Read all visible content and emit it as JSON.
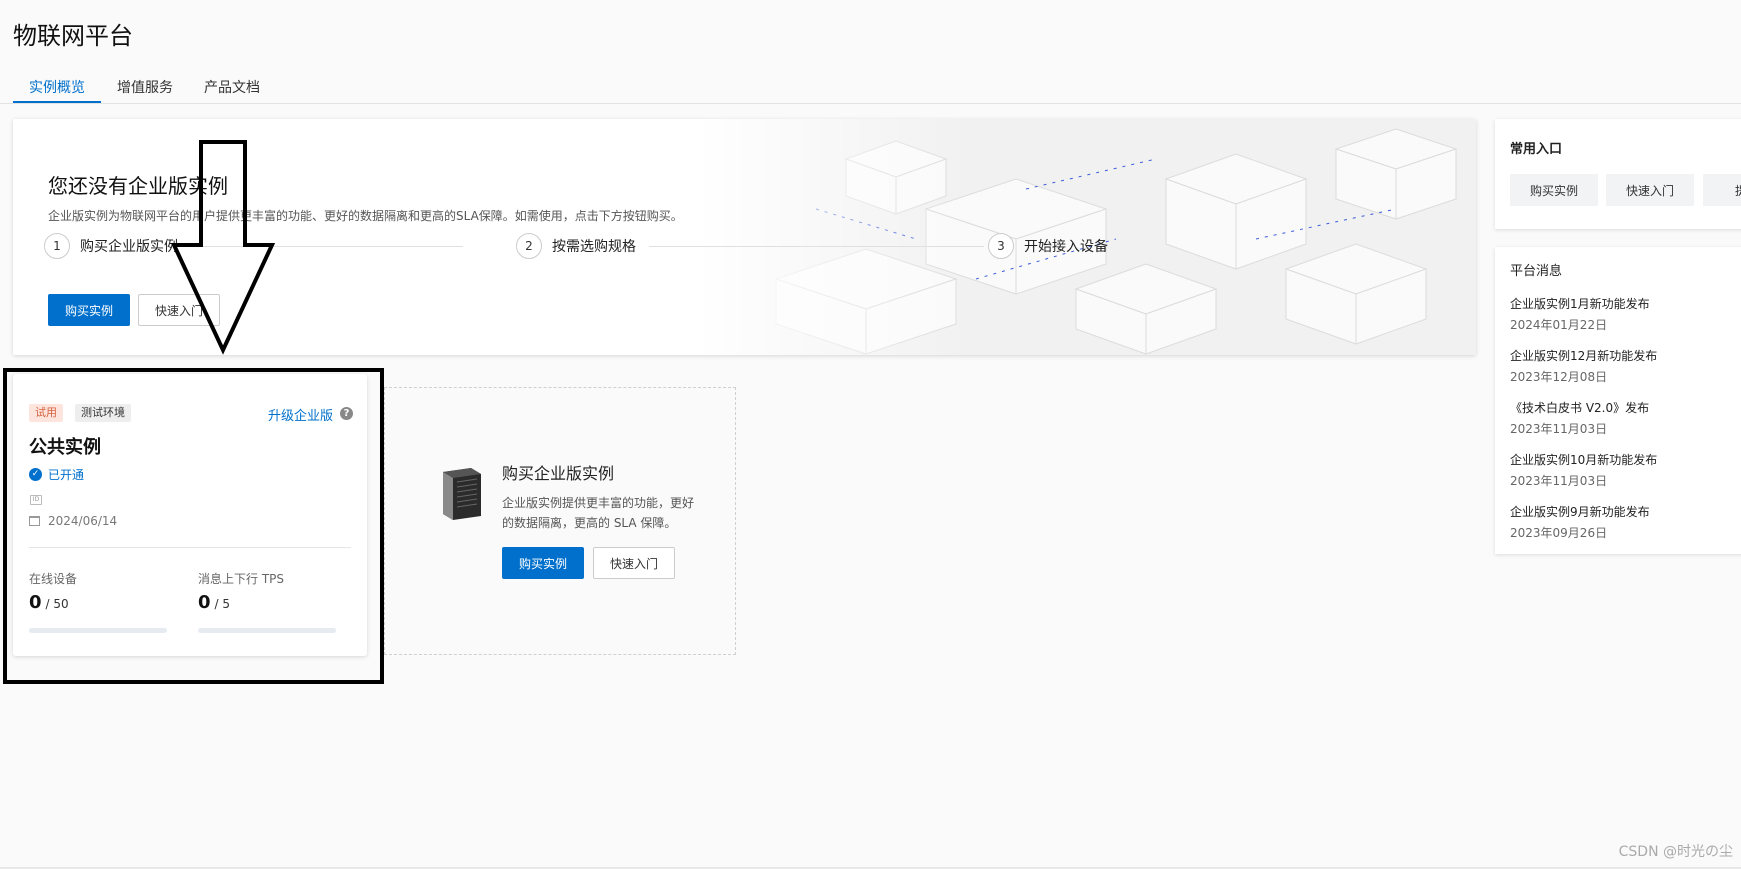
{
  "page": {
    "title": "物联网平台"
  },
  "tabs": [
    {
      "label": "实例概览",
      "active": true
    },
    {
      "label": "增值服务",
      "active": false
    },
    {
      "label": "产品文档",
      "active": false
    }
  ],
  "hero": {
    "title": "您还没有企业版实例",
    "description": "企业版实例为物联网平台的用户提供更丰富的功能、更好的数据隔离和更高的SLA保障。如需使用，点击下方按钮购买。",
    "steps": [
      {
        "num": "1",
        "label": "购买企业版实例"
      },
      {
        "num": "2",
        "label": "按需选购规格"
      },
      {
        "num": "3",
        "label": "开始接入设备"
      }
    ],
    "buy_button": "购买实例",
    "quickstart_button": "快速入门"
  },
  "instance_card": {
    "badge_trial": "试用",
    "badge_env": "测试环境",
    "upgrade_link": "升级企业版",
    "help_glyph": "?",
    "title": "公共实例",
    "status": "已开通",
    "status_glyph": "✓",
    "id_glyph": "ID",
    "date": "2024/06/14",
    "metrics": [
      {
        "label": "在线设备",
        "value": "0",
        "max": "/ 50",
        "fraction": 0
      },
      {
        "label": "消息上下行 TPS",
        "value": "0",
        "max": "/ 5",
        "fraction": 0
      }
    ]
  },
  "buy_panel": {
    "title": "购买企业版实例",
    "description": "企业版实例提供更丰富的功能，更好的数据隔离，更高的 SLA 保障。",
    "buy_button": "购买实例",
    "quickstart_button": "快速入门"
  },
  "common_entries": {
    "title": "常用入口",
    "items": [
      "购买实例",
      "快速入门",
      "提交"
    ]
  },
  "platform_news": {
    "title": "平台消息",
    "items": [
      {
        "title": "企业版实例1月新功能发布",
        "date": "2024年01月22日"
      },
      {
        "title": "企业版实例12月新功能发布",
        "date": "2023年12月08日"
      },
      {
        "title": "《技术白皮书 V2.0》发布",
        "date": "2023年11月03日"
      },
      {
        "title": "企业版实例10月新功能发布",
        "date": "2023年11月03日"
      },
      {
        "title": "企业版实例9月新功能发布",
        "date": "2023年09月26日"
      }
    ]
  },
  "watermark": "CSDN @时光の尘",
  "colors": {
    "primary": "#0070cc",
    "trial_badge_bg": "#fde4dc",
    "trial_badge_text": "#d4603d"
  }
}
